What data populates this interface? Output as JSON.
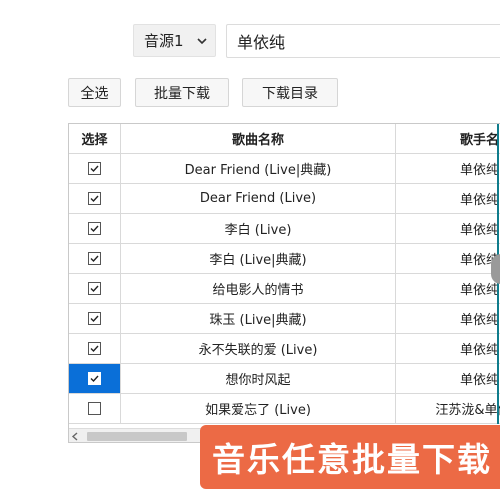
{
  "toolbar": {
    "source_select": "音源1",
    "search_value": "单依纯",
    "select_all_label": "全选",
    "batch_download_label": "批量下载",
    "download_dir_label": "下载目录"
  },
  "table": {
    "headers": [
      "选择",
      "歌曲名称",
      "歌手名"
    ],
    "rows": [
      {
        "checked": true,
        "title": "Dear Friend (Live|典藏)",
        "artist": "单依纯"
      },
      {
        "checked": true,
        "title": "Dear Friend (Live)",
        "artist": "单依纯"
      },
      {
        "checked": true,
        "title": "李白 (Live)",
        "artist": "单依纯"
      },
      {
        "checked": true,
        "title": "李白 (Live|典藏)",
        "artist": "单依纯"
      },
      {
        "checked": true,
        "title": "给电影人的情书",
        "artist": "单依纯"
      },
      {
        "checked": true,
        "title": "珠玉 (Live|典藏)",
        "artist": "单依纯"
      },
      {
        "checked": true,
        "title": "永不失联的爱 (Live)",
        "artist": "单依纯"
      },
      {
        "checked": true,
        "selected": true,
        "title": "想你时风起",
        "artist": "单依纯"
      },
      {
        "checked": false,
        "title": "如果爱忘了 (Live)",
        "artist": "汪苏泷&单依纯"
      }
    ]
  },
  "banner": {
    "text": "音乐任意批量下载"
  },
  "colors": {
    "selection": "#0a6fd8",
    "banner": "#ec6a45",
    "accent": "#0f7c8c"
  }
}
